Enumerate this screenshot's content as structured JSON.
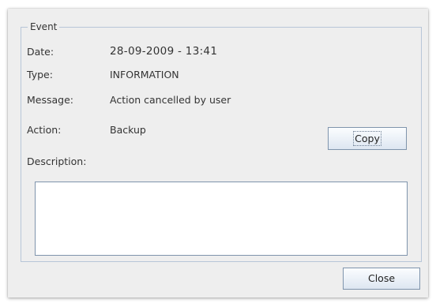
{
  "event_group": {
    "legend": "Event"
  },
  "fields": {
    "date_label": "Date:",
    "date_value": "28-09-2009 - 13:41",
    "type_label": "Type:",
    "type_value": "INFORMATION",
    "message_label": "Message:",
    "message_value": "Action cancelled by user",
    "action_label": "Action:",
    "action_value": "Backup",
    "description_label": "Description:",
    "description_value": ""
  },
  "buttons": {
    "copy_label": "Copy",
    "close_label": "Close"
  }
}
